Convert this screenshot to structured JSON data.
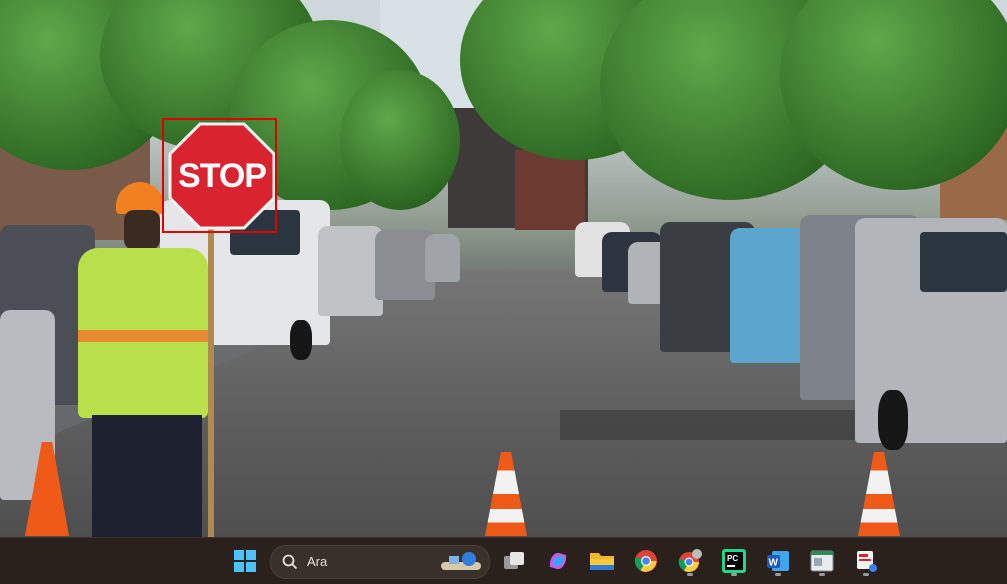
{
  "scene": {
    "sign_text": "STOP",
    "description_none": ""
  },
  "taskbar": {
    "search_placeholder": "Ara",
    "apps": [
      {
        "name": "start-icon"
      },
      {
        "name": "task-view-icon"
      },
      {
        "name": "copilot-icon"
      },
      {
        "name": "file-explorer-icon"
      },
      {
        "name": "chrome-icon"
      },
      {
        "name": "chrome-profile-icon"
      },
      {
        "name": "pycharm-icon"
      },
      {
        "name": "word-icon"
      },
      {
        "name": "app-window-icon"
      },
      {
        "name": "snipping-tool-icon"
      }
    ]
  },
  "colors": {
    "selection_box": "#e00000",
    "taskbar_bg": "#2a201c",
    "stop_red": "#d9232e"
  }
}
